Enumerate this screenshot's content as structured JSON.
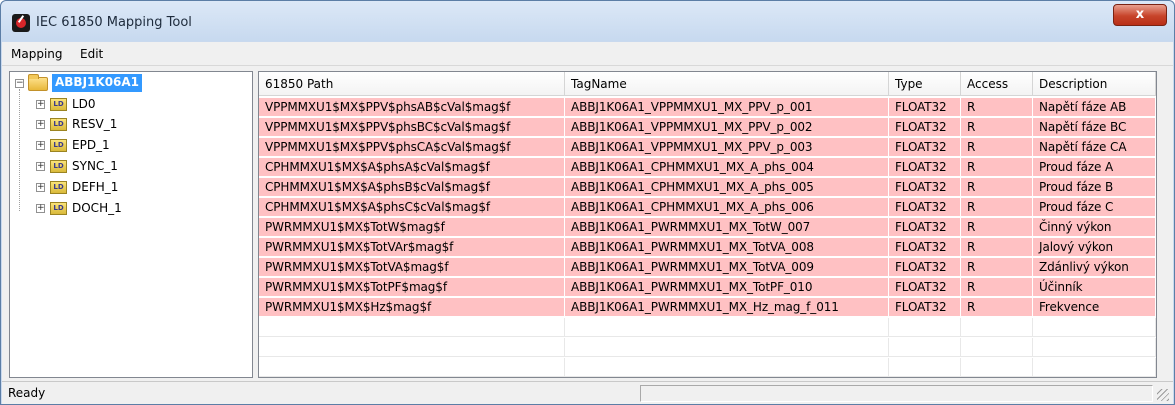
{
  "window": {
    "title": "IEC 61850 Mapping Tool",
    "close_label": "x"
  },
  "menu": {
    "items": [
      {
        "label": "Mapping"
      },
      {
        "label": "Edit"
      }
    ]
  },
  "tree": {
    "root": {
      "label": "ABBJ1K06A1",
      "expanded": true,
      "selected": true
    },
    "children": [
      {
        "label": "LD0",
        "icon": "LD"
      },
      {
        "label": "RESV_1",
        "icon": "LD"
      },
      {
        "label": "EPD_1",
        "icon": "LD"
      },
      {
        "label": "SYNC_1",
        "icon": "LD"
      },
      {
        "label": "DEFH_1",
        "icon": "LD"
      },
      {
        "label": "DOCH_1",
        "icon": "LD"
      }
    ]
  },
  "table": {
    "columns": [
      "61850 Path",
      "TagName",
      "Type",
      "Access",
      "Description"
    ],
    "rows": [
      [
        "VPPMMXU1$MX$PPV$phsAB$cVal$mag$f",
        "ABBJ1K06A1_VPPMMXU1_MX_PPV_p_001",
        "FLOAT32",
        "R",
        "Napětí fáze AB"
      ],
      [
        "VPPMMXU1$MX$PPV$phsBC$cVal$mag$f",
        "ABBJ1K06A1_VPPMMXU1_MX_PPV_p_002",
        "FLOAT32",
        "R",
        "Napětí fáze BC"
      ],
      [
        "VPPMMXU1$MX$PPV$phsCA$cVal$mag$f",
        "ABBJ1K06A1_VPPMMXU1_MX_PPV_p_003",
        "FLOAT32",
        "R",
        "Napětí fáze CA"
      ],
      [
        "CPHMMXU1$MX$A$phsA$cVal$mag$f",
        "ABBJ1K06A1_CPHMMXU1_MX_A_phs_004",
        "FLOAT32",
        "R",
        "Proud fáze A"
      ],
      [
        "CPHMMXU1$MX$A$phsB$cVal$mag$f",
        "ABBJ1K06A1_CPHMMXU1_MX_A_phs_005",
        "FLOAT32",
        "R",
        "Proud fáze B"
      ],
      [
        "CPHMMXU1$MX$A$phsC$cVal$mag$f",
        "ABBJ1K06A1_CPHMMXU1_MX_A_phs_006",
        "FLOAT32",
        "R",
        "Proud fáze C"
      ],
      [
        "PWRMMXU1$MX$TotW$mag$f",
        "ABBJ1K06A1_PWRMMXU1_MX_TotW_007",
        "FLOAT32",
        "R",
        "Činný výkon"
      ],
      [
        "PWRMMXU1$MX$TotVAr$mag$f",
        "ABBJ1K06A1_PWRMMXU1_MX_TotVA_008",
        "FLOAT32",
        "R",
        "Jalový výkon"
      ],
      [
        "PWRMMXU1$MX$TotVA$mag$f",
        "ABBJ1K06A1_PWRMMXU1_MX_TotVA_009",
        "FLOAT32",
        "R",
        "Zdánlivý výkon"
      ],
      [
        "PWRMMXU1$MX$TotPF$mag$f",
        "ABBJ1K06A1_PWRMMXU1_MX_TotPF_010",
        "FLOAT32",
        "R",
        "Účinník"
      ],
      [
        "PWRMMXU1$MX$Hz$mag$f",
        "ABBJ1K06A1_PWRMMXU1_MX_Hz_mag_f_011",
        "FLOAT32",
        "R",
        "Frekvence"
      ]
    ]
  },
  "status": {
    "text": "Ready"
  },
  "colors": {
    "row_highlight": "#ffc1c3",
    "selection": "#3399ff",
    "close_button": "#c7442a"
  }
}
